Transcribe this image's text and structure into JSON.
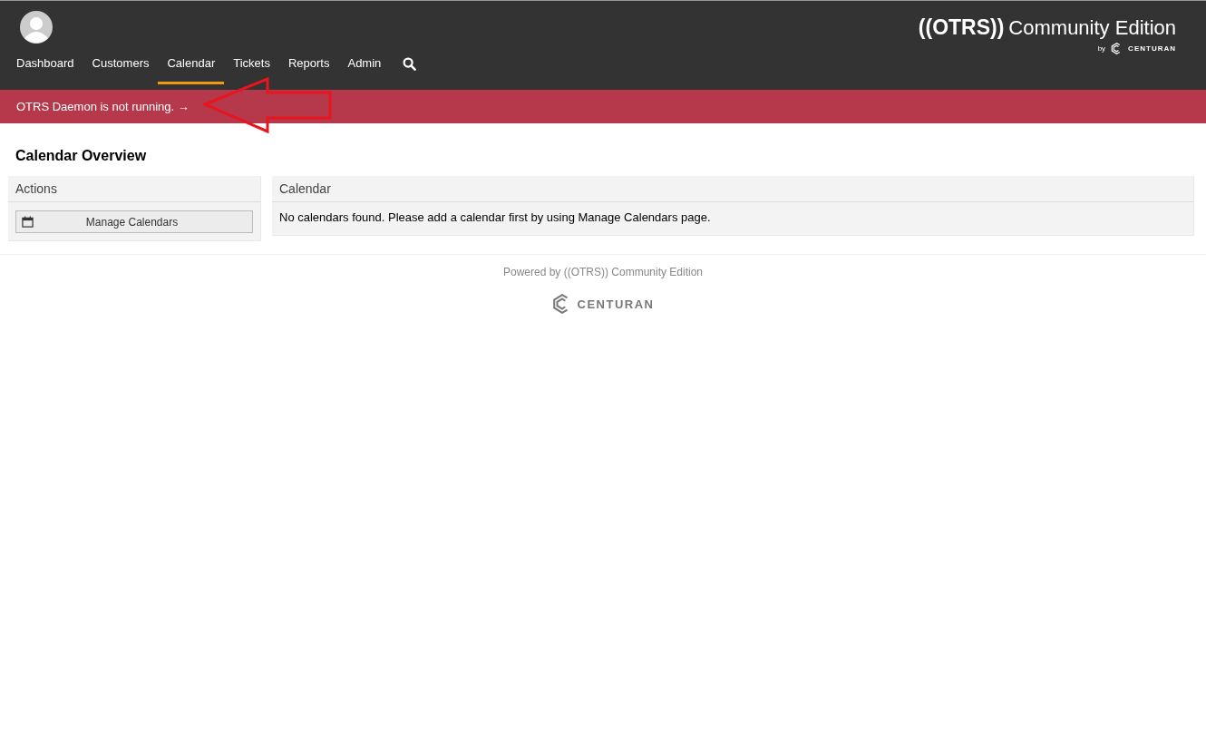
{
  "header": {
    "logo": {
      "brand": "((OTRS))",
      "edition": "Community Edition",
      "by": "by",
      "company": "CENTURAN"
    },
    "nav": [
      {
        "label": "Dashboard",
        "selected": false
      },
      {
        "label": "Customers",
        "selected": false
      },
      {
        "label": "Calendar",
        "selected": true
      },
      {
        "label": "Tickets",
        "selected": false
      },
      {
        "label": "Reports",
        "selected": false
      },
      {
        "label": "Admin",
        "selected": false
      }
    ]
  },
  "notification": {
    "text": "OTRS Daemon is not running. →"
  },
  "page_title": "Calendar Overview",
  "actions": {
    "title": "Actions",
    "buttons": [
      "Manage Calendars"
    ]
  },
  "calendar": {
    "title": "Calendar",
    "message": "No calendars found. Please add a calendar first by using Manage Calendars page."
  },
  "footer": {
    "powered_by": "Powered by ((OTRS)) Community Edition",
    "company": "CENTURAN"
  }
}
